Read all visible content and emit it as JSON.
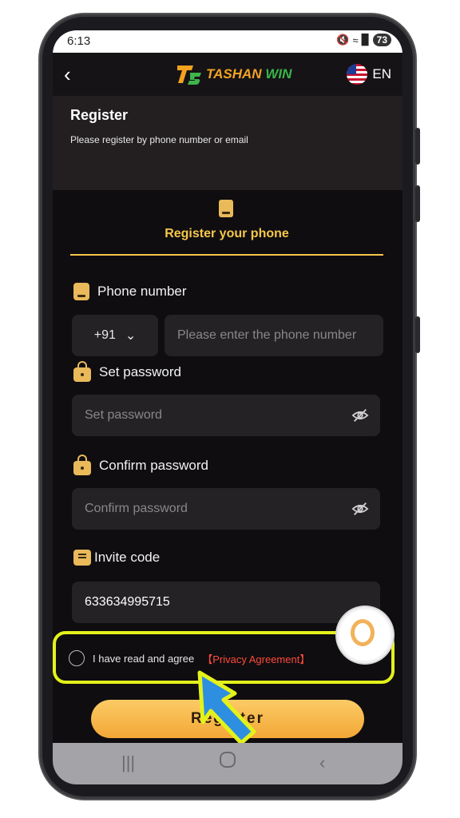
{
  "status": {
    "time": "6:13",
    "battery": "73"
  },
  "header": {
    "brand_part1": "TASHAN",
    "brand_part2": "WIN",
    "lang": "EN"
  },
  "page": {
    "title": "Register",
    "subtitle": "Please register by phone number or email"
  },
  "tab": {
    "label": "Register your phone"
  },
  "phone": {
    "label": "Phone number",
    "country_code": "+91",
    "placeholder": "Please enter the phone number"
  },
  "password": {
    "label": "Set password",
    "placeholder": "Set password"
  },
  "confirm": {
    "label": "Confirm password",
    "placeholder": "Confirm password"
  },
  "invite": {
    "label": "Invite code",
    "value": "633634995715"
  },
  "agree": {
    "text": "I have read and agree",
    "link": "【Privacy Agreement】"
  },
  "register_button": "Register",
  "colors": {
    "accent": "#f6c74a",
    "button": "#f3a736",
    "link": "#ff4b3a",
    "highlight": "#e4f21a",
    "pointer": "#2e8fe0"
  },
  "icons": [
    "back-arrow-icon",
    "flag-us-icon",
    "phone-icon",
    "lock-icon",
    "gift-icon",
    "eye-off-icon",
    "support-icon",
    "nav-recents-icon",
    "nav-home-icon",
    "nav-back-icon"
  ]
}
